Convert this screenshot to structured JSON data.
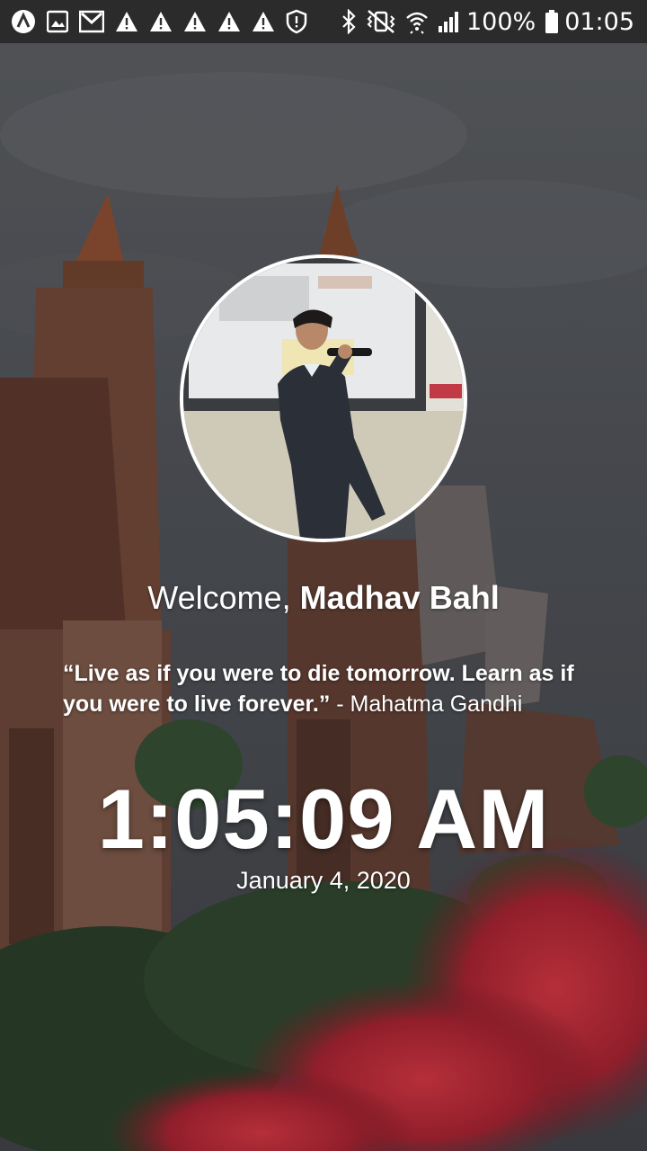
{
  "status_bar": {
    "left_icons": [
      "app-logo-icon",
      "gallery-icon",
      "gmail-icon",
      "warning-icon",
      "warning-icon",
      "warning-icon",
      "warning-icon",
      "warning-icon",
      "shield-alert-icon"
    ],
    "right_icons": [
      "bluetooth-icon",
      "vibrate-mute-icon",
      "wifi-icon",
      "signal-icon",
      "battery-icon"
    ],
    "battery": "100%",
    "time": "01:05"
  },
  "profile": {
    "welcome_prefix": "Welcome, ",
    "name": "Madhav Bahl"
  },
  "quote": {
    "text": "“Live as if you were to die tomorrow. Learn as if you were to live forever.”",
    "author": " - Mahatma Gandhi"
  },
  "clock": {
    "time": "1:05:09 AM",
    "date": "January 4, 2020"
  },
  "colors": {
    "status_bar": "#282828",
    "text": "#ffffff",
    "overlay": "#2b2e33"
  }
}
